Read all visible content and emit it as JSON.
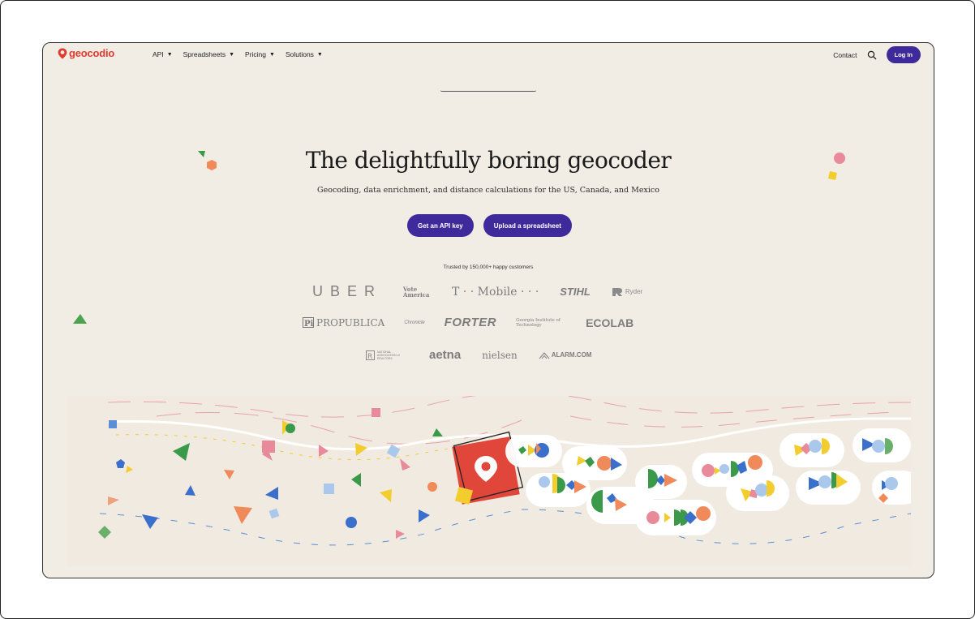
{
  "nav": {
    "brand": "geocodio",
    "menu": [
      {
        "label": "API"
      },
      {
        "label": "Spreadsheets"
      },
      {
        "label": "Pricing"
      },
      {
        "label": "Solutions"
      }
    ],
    "contact": "Contact",
    "login": "Log In",
    "caret": "▼"
  },
  "hero": {
    "headline": "The delightfully boring geocoder",
    "subtitle": "Geocoding, data enrichment, and distance calculations for the US, Canada, and Mexico",
    "cta_primary": "Get an API key",
    "cta_secondary": "Upload a spreadsheet",
    "trusted": "Trusted by 150,000+ happy customers"
  },
  "customers": {
    "row1": [
      "UBER",
      "Vote America",
      "T · · Mobile · · ·",
      "STIHL",
      "Ryder"
    ],
    "row2": [
      "PROPUBLICA",
      "Chronicle",
      "FORTER",
      "Georgia Institute of Technology",
      "ECOLAB"
    ],
    "row3": [
      "NATIONAL ASSOCIATION of REALTORS",
      "aetna",
      "nielsen",
      "ALARM.COM"
    ]
  },
  "colors": {
    "brand_red": "#e03a2f",
    "button_purple": "#3f2a9c",
    "background": "#f1ede4"
  }
}
